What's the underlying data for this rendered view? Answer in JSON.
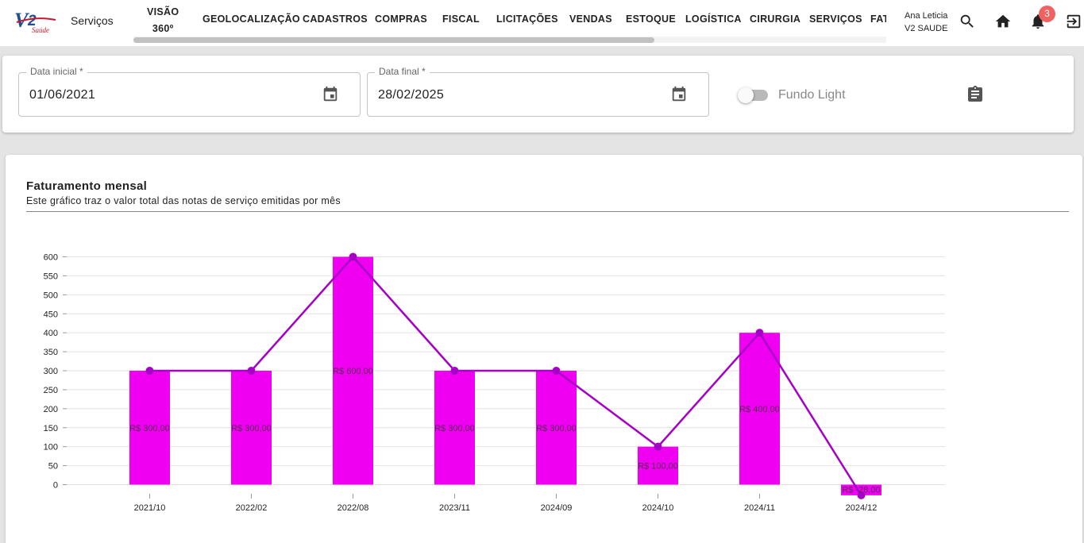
{
  "header": {
    "section_title": "Serviços",
    "nav": [
      {
        "label": "VISÃO",
        "label2": "360º"
      },
      {
        "label": "GEOLOCALIZAÇÃO"
      },
      {
        "label": "CADASTROS"
      },
      {
        "label": "COMPRAS"
      },
      {
        "label": "FISCAL"
      },
      {
        "label": "LICITAÇÕES"
      },
      {
        "label": "VENDAS"
      },
      {
        "label": "ESTOQUE"
      },
      {
        "label": "LOGÍSTICA"
      },
      {
        "label": "CIRURGIA"
      },
      {
        "label": "SERVIÇOS"
      },
      {
        "label": "FAT"
      }
    ],
    "user_name": "Ana Leticia",
    "user_company": "V2 SAUDE",
    "notification_count": "3",
    "icons": [
      "search-icon",
      "home-icon",
      "bell-icon",
      "logout-icon"
    ]
  },
  "filters": {
    "start_date_label": "Data inicial *",
    "start_date_value": "01/06/2021",
    "end_date_label": "Data final *",
    "end_date_value": "28/02/2025",
    "toggle_label": "Fundo Light",
    "toggle_on": false
  },
  "chart": {
    "title": "Faturamento mensal",
    "subtitle": "Este gráfico traz o valor total das notas de serviço emitidas por mês"
  },
  "colors": {
    "bar": "#f000f0",
    "line": "#a600c6",
    "grid": "#e2e2e2",
    "badge": "#f06262"
  },
  "chart_data": {
    "type": "bar",
    "categories": [
      "2021/10",
      "2022/02",
      "2022/08",
      "2023/11",
      "2024/09",
      "2024/10",
      "2024/11",
      "2024/12"
    ],
    "values": [
      300,
      300,
      600,
      300,
      300,
      100,
      400,
      -28
    ],
    "data_labels": [
      "R$ 300,00",
      "R$ 300,00",
      "R$ 600,00",
      "R$ 300,00",
      "R$ 300,00",
      "R$ 100,00",
      "R$ 400,00",
      "R$ -28,00"
    ],
    "overlay_line": true,
    "yticks": [
      "0",
      "50",
      "100",
      "150",
      "200",
      "250",
      "300",
      "350",
      "400",
      "450",
      "500",
      "550",
      "600"
    ],
    "ylim": [
      0,
      600
    ],
    "grid": true
  }
}
